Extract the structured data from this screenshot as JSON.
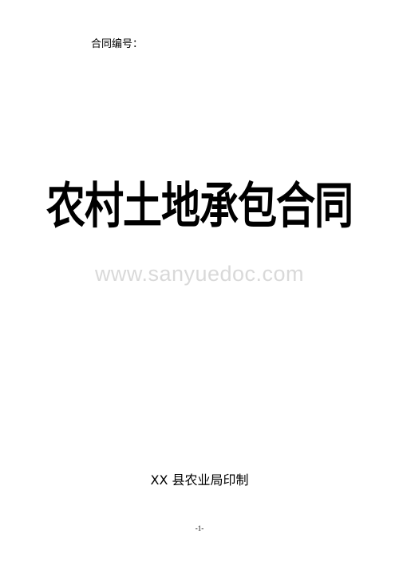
{
  "document": {
    "contract_number_label": "合同编号：",
    "title": "农村土地承包合同",
    "watermark": "www.sanyuedoc.com",
    "publisher": "XX 县农业局印制",
    "page_number": "-1-"
  }
}
